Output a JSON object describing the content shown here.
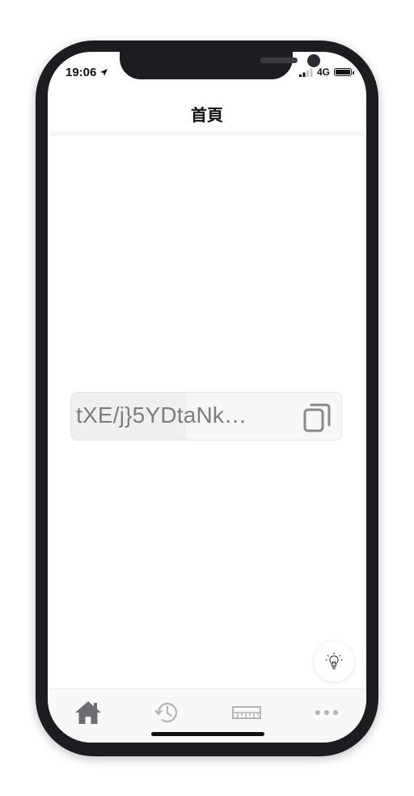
{
  "status_bar": {
    "time": "19:06",
    "network": "4G"
  },
  "header": {
    "title": "首頁"
  },
  "main": {
    "key_text": "tXE/j}5YDtaNk…"
  },
  "icons": {
    "location": "location-arrow-icon",
    "signal": "cellular-signal-icon",
    "battery": "battery-icon",
    "copy": "copy-icon",
    "tip": "lightbulb-icon",
    "home": "home-icon",
    "history": "history-icon",
    "ruler": "ruler-icon",
    "more": "more-icon"
  },
  "tabbar": {
    "items": [
      {
        "name": "home",
        "active": true
      },
      {
        "name": "history",
        "active": false
      },
      {
        "name": "ruler",
        "active": false
      },
      {
        "name": "more",
        "active": false
      }
    ]
  },
  "colors": {
    "active_icon": "#6d6d72",
    "inactive_icon": "#b4b4b4",
    "key_text": "#7d7d7d"
  }
}
